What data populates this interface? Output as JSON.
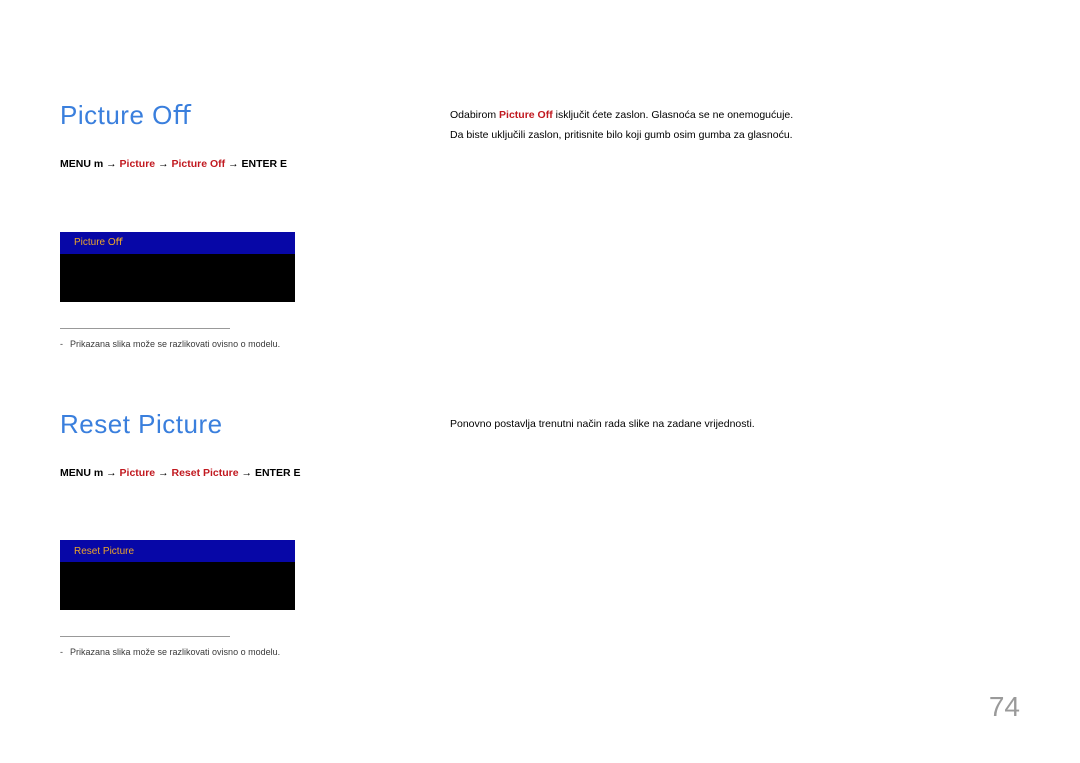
{
  "section1": {
    "heading": "Picture Oﬀ",
    "path_prefix": "MENU",
    "path_menu_sym": "m",
    "path_arrow": "→",
    "path_picture": "Picture",
    "path_item": "Picture Off",
    "path_enter": "ENTER",
    "path_enter_sym": "E",
    "menu_bar_label": "Picture Oﬀ",
    "footnote": "Prikazana slika može se razlikovati ovisno o modelu.",
    "desc_line1_a": "Odabirom ",
    "desc_line1_red": "Picture Off",
    "desc_line1_b": " isključit ćete zaslon. Glasnoća se ne onemogućuje.",
    "desc_line2": "Da biste uključili zaslon, pritisnite bilo koji gumb osim gumba za glasnoću."
  },
  "section2": {
    "heading": "Reset Picture",
    "path_prefix": "MENU",
    "path_menu_sym": "m",
    "path_arrow": "→",
    "path_picture": "Picture",
    "path_item": "Reset Picture",
    "path_enter": "ENTER",
    "path_enter_sym": "E",
    "menu_bar_label": "Reset Picture",
    "footnote": "Prikazana slika može se razlikovati ovisno o modelu.",
    "desc": "Ponovno postavlja trenutni način rada slike na zadane vrijednosti."
  },
  "page_number": "74"
}
